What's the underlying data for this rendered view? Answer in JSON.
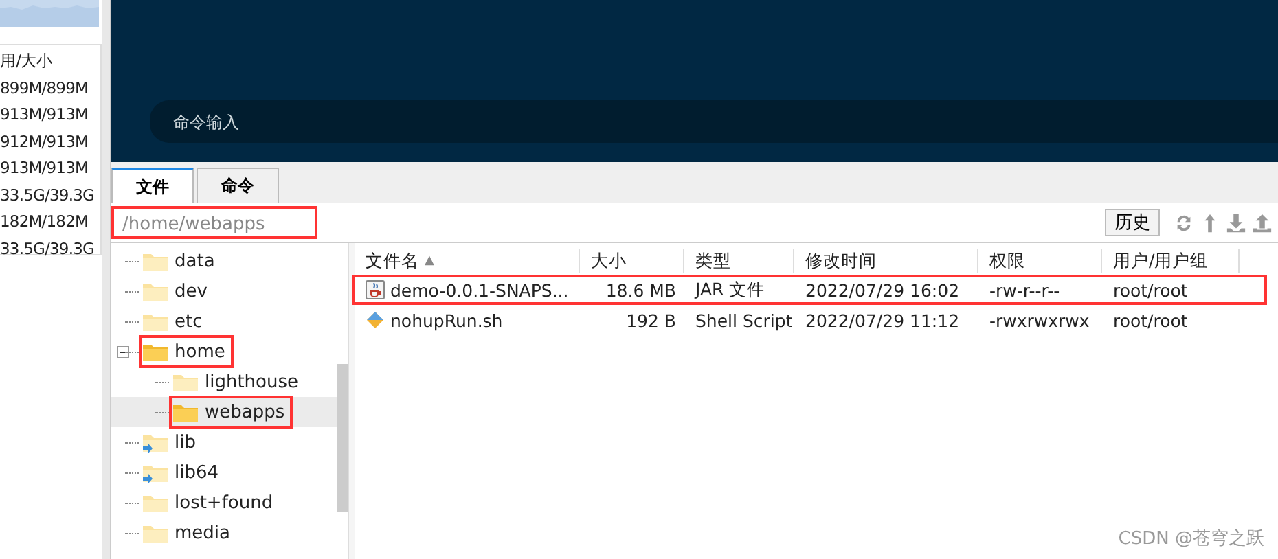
{
  "memory_table": {
    "header": "用/大小",
    "rows": [
      "899M/899M",
      "913M/913M",
      "912M/913M",
      "913M/913M",
      "33.5G/39.3G",
      "182M/182M",
      "33.5G/39.3G"
    ]
  },
  "terminal": {
    "command_placeholder": "命令输入"
  },
  "tabs": [
    {
      "label": "文件",
      "selected": true
    },
    {
      "label": "命令",
      "selected": false
    }
  ],
  "path": {
    "value": "/home/webapps",
    "highlighted": true
  },
  "toolbar": {
    "history_button": "历史"
  },
  "tree": [
    {
      "name": "data",
      "kind": "folder",
      "selected": false,
      "highlighted": false
    },
    {
      "name": "dev",
      "kind": "folder",
      "selected": false,
      "highlighted": false
    },
    {
      "name": "etc",
      "kind": "folder",
      "selected": false,
      "highlighted": false
    },
    {
      "name": "home",
      "kind": "folder",
      "expanded": true,
      "selected": false,
      "highlighted": true,
      "children": [
        {
          "name": "lighthouse",
          "kind": "folder",
          "selected": false,
          "highlighted": false
        },
        {
          "name": "webapps",
          "kind": "folder",
          "selected": true,
          "highlighted": true
        }
      ]
    },
    {
      "name": "lib",
      "kind": "link",
      "selected": false,
      "highlighted": false
    },
    {
      "name": "lib64",
      "kind": "link",
      "selected": false,
      "highlighted": false
    },
    {
      "name": "lost+found",
      "kind": "folder",
      "selected": false,
      "highlighted": false
    },
    {
      "name": "media",
      "kind": "folder",
      "selected": false,
      "highlighted": false
    }
  ],
  "files": {
    "columns": [
      "文件名",
      "大小",
      "类型",
      "修改时间",
      "权限",
      "用户/用户组"
    ],
    "sort_indicator": "▲",
    "rows": [
      {
        "name": "demo-0.0.1-SNAPS...",
        "size": "18.6 MB",
        "type": "JAR 文件",
        "modified": "2022/07/29 16:02",
        "permissions": "-rw-r--r--",
        "owner": "root/root",
        "kind": "jar",
        "highlighted": true
      },
      {
        "name": "nohupRun.sh",
        "size": "192 B",
        "type": "Shell Script",
        "modified": "2022/07/29 11:12",
        "permissions": "-rwxrwxrwx",
        "owner": "root/root",
        "kind": "script",
        "highlighted": false
      }
    ]
  },
  "watermark_text": "CSDN @苍穹之跃"
}
